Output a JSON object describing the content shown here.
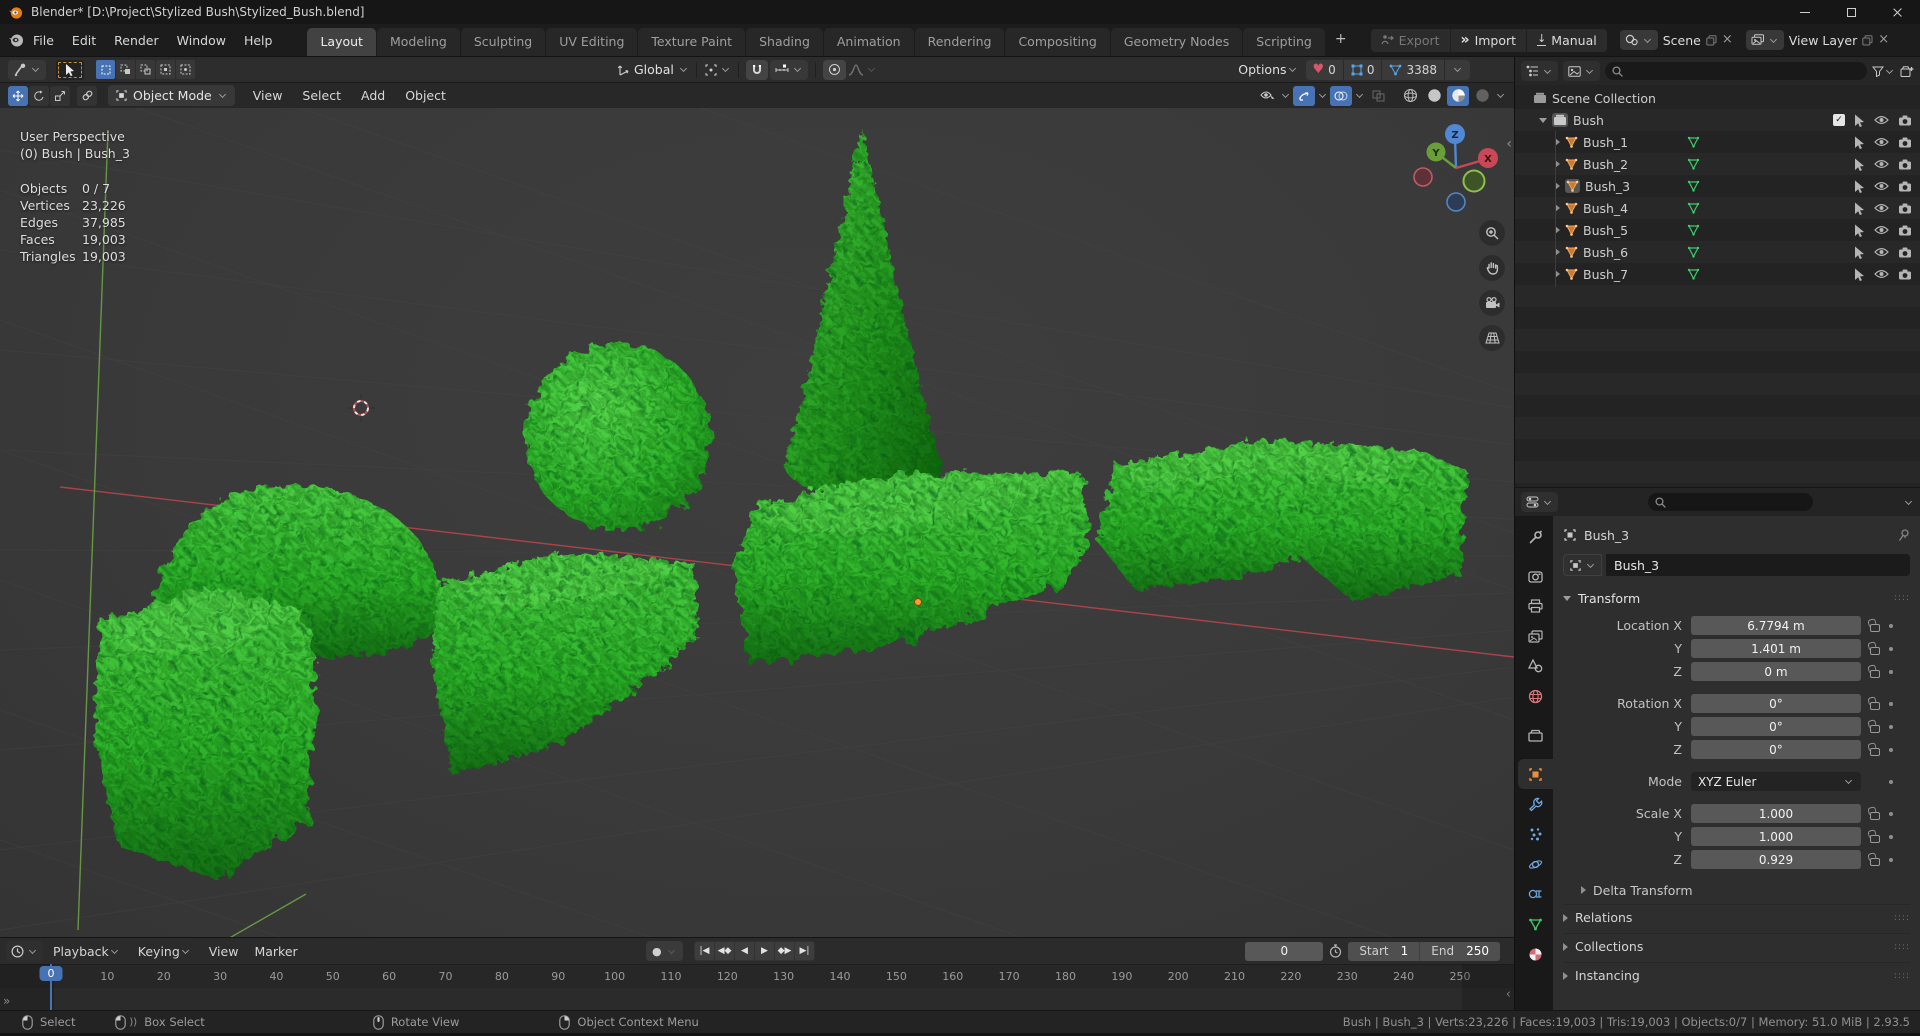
{
  "window": {
    "title": "Blender* [D:\\Project\\Stylized Bush\\Stylized_Bush.blend]"
  },
  "topbar": {
    "menus": [
      "File",
      "Edit",
      "Render",
      "Window",
      "Help"
    ],
    "workspaces": [
      {
        "label": "Layout",
        "active": true
      },
      {
        "label": "Modeling"
      },
      {
        "label": "Sculpting"
      },
      {
        "label": "UV Editing"
      },
      {
        "label": "Texture Paint"
      },
      {
        "label": "Shading"
      },
      {
        "label": "Animation"
      },
      {
        "label": "Rendering"
      },
      {
        "label": "Compositing"
      },
      {
        "label": "Geometry Nodes"
      },
      {
        "label": "Scripting"
      }
    ],
    "add_tab": "+",
    "quick": {
      "export": "Export",
      "import": "Import",
      "manual": "Manual"
    },
    "scene": {
      "label": "Scene"
    },
    "view_layer": {
      "label": "View Layer"
    }
  },
  "tool_header": {
    "orientation": "Global",
    "options": "Options",
    "counts": {
      "hearts": "0",
      "squares": "0",
      "triangles": "3388"
    }
  },
  "viewport_header": {
    "mode": "Object Mode",
    "menus": [
      "View",
      "Select",
      "Add",
      "Object"
    ]
  },
  "viewport": {
    "overlay": {
      "perspective": "User Perspective",
      "context": "(0) Bush | Bush_3",
      "stats": [
        {
          "label": "Objects",
          "value": "0 / 7"
        },
        {
          "label": "Vertices",
          "value": "23,226"
        },
        {
          "label": "Edges",
          "value": "37,985"
        },
        {
          "label": "Faces",
          "value": "19,003"
        },
        {
          "label": "Triangles",
          "value": "19,003"
        }
      ]
    },
    "gizmo": {
      "x": "X",
      "y": "Y",
      "z": "Z"
    }
  },
  "outliner": {
    "root": "Scene Collection",
    "collection": "Bush",
    "objects": [
      {
        "name": "Bush_1"
      },
      {
        "name": "Bush_2"
      },
      {
        "name": "Bush_3",
        "active": true
      },
      {
        "name": "Bush_4"
      },
      {
        "name": "Bush_5"
      },
      {
        "name": "Bush_6"
      },
      {
        "name": "Bush_7"
      }
    ]
  },
  "properties": {
    "breadcrumb": "Bush_3",
    "name_value": "Bush_3",
    "transform": {
      "title": "Transform",
      "loc_rot_rows": [
        {
          "label": "Location X",
          "value": "6.7794 m"
        },
        {
          "label": "Y",
          "value": "1.401 m"
        },
        {
          "label": "Z",
          "value": "0 m"
        },
        {
          "label": "Rotation X",
          "value": "0°",
          "gap": true
        },
        {
          "label": "Y",
          "value": "0°"
        },
        {
          "label": "Z",
          "value": "0°"
        }
      ],
      "mode_label": "Mode",
      "mode_value": "XYZ Euler",
      "scale_rows": [
        {
          "label": "Scale X",
          "value": "1.000",
          "gap": true
        },
        {
          "label": "Y",
          "value": "1.000"
        },
        {
          "label": "Z",
          "value": "0.929"
        }
      ],
      "delta_label": "Delta Transform"
    },
    "panels": [
      "Relations",
      "Collections",
      "Instancing"
    ]
  },
  "timeline": {
    "playback": "Playback",
    "keying": "Keying",
    "menus": [
      "View",
      "Marker"
    ],
    "current_frame": "0",
    "start_label": "Start",
    "start_value": "1",
    "end_label": "End",
    "end_value": "250",
    "ticks": [
      0,
      10,
      20,
      30,
      40,
      50,
      60,
      70,
      80,
      90,
      100,
      110,
      120,
      130,
      140,
      150,
      160,
      170,
      180,
      190,
      200,
      210,
      220,
      230,
      240,
      250
    ]
  },
  "status_bar": {
    "hints": [
      {
        "label": "Select",
        "button": "left"
      },
      {
        "label": "Box Select",
        "button": "left-drag"
      },
      {
        "label": "Rotate View",
        "button": "middle"
      },
      {
        "label": "Object Context Menu",
        "button": "right"
      }
    ],
    "stats": "Bush | Bush_3 | Verts:23,226 | Faces:19,003 | Tris:19,003 | Objects:0/7 | Memory: 51.0 MiB | 2.93.5"
  },
  "icons": {
    "check": "✓",
    "record": "●",
    "heart": "♥",
    "double_chevron": "»",
    "download": "↓",
    "close_x": "×",
    "collapse": "‹",
    "corner": "»",
    "drag_handle": "::::",
    "transport": [
      "|◀",
      "◀◆",
      "◀",
      "▶",
      "◆▶",
      "▶|"
    ]
  },
  "colors": {
    "accent": "#4772b3",
    "object_orange": "#e8913c",
    "mesh_green": "#3fc96d",
    "axis_x": "#b8434c",
    "axis_y": "#6fa845",
    "bush_light": "#4ecf45",
    "bush_dark": "#156f15"
  }
}
